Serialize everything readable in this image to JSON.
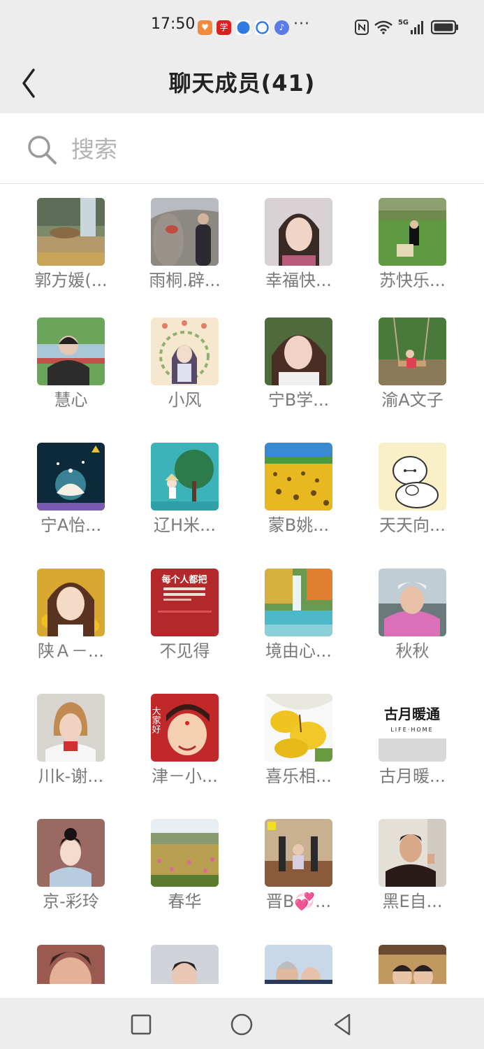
{
  "status_bar": {
    "time": "17:50",
    "more": "···",
    "network": "5G"
  },
  "header": {
    "title": "聊天成员(41)"
  },
  "search": {
    "placeholder": "搜索"
  },
  "members": [
    {
      "name": "郭方媛(..."
    },
    {
      "name": "雨桐.辟..."
    },
    {
      "name": "幸福快..."
    },
    {
      "name": "苏快乐..."
    },
    {
      "name": "慧心"
    },
    {
      "name": "小风"
    },
    {
      "name": "宁B学..."
    },
    {
      "name": "渝A文子"
    },
    {
      "name": "宁A怡..."
    },
    {
      "name": "辽H米..."
    },
    {
      "name": "蒙B姚..."
    },
    {
      "name": "天天向..."
    },
    {
      "name": "陕Ａ－..."
    },
    {
      "name": "不见得"
    },
    {
      "name": "境由心..."
    },
    {
      "name": "秋秋"
    },
    {
      "name": "川k-谢..."
    },
    {
      "name": "津－小..."
    },
    {
      "name": "喜乐相..."
    },
    {
      "name": "古月暖..."
    },
    {
      "name": "京-彩玲"
    },
    {
      "name": "春华"
    },
    {
      "name": "晋B💞..."
    },
    {
      "name": "黑E自..."
    },
    {
      "name": ""
    },
    {
      "name": ""
    },
    {
      "name": ""
    },
    {
      "name": ""
    }
  ],
  "avatar_text": {
    "gu_yue_brand": "古月暖通",
    "gu_yue_sub": "LIFE·HOME",
    "da_jia_hao": "大家好",
    "bu_jian_de": "每个人都把"
  },
  "colors": {
    "background": "#ededed",
    "text_primary": "#222222",
    "text_name": "#7a7a7a",
    "placeholder": "#b3b3b3"
  }
}
